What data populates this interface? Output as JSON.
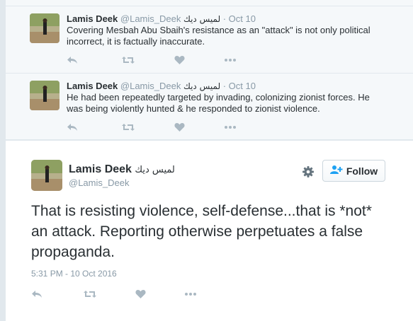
{
  "replies": [
    {
      "name": "Lamis Deek",
      "handle": "@Lamis_Deek",
      "name_ar": "لميس ديك",
      "date": "· Oct 10",
      "text": "Covering Mesbah Abu Sbaih's resistance as an \"attack\" is not only political incorrect, it is factually inaccurate."
    },
    {
      "name": "Lamis Deek",
      "handle": "@Lamis_Deek",
      "name_ar": "لميس ديك",
      "date": "· Oct 10",
      "text": "He had been repeatedly targeted by invading, colonizing zionist forces. He was being violently hunted & he responded to zionist violence."
    }
  ],
  "main_tweet": {
    "name": "Lamis Deek",
    "name_ar": "لميس ديك",
    "handle": "@Lamis_Deek",
    "follow_label": "Follow",
    "text": "That is resisting violence, self-defense...that is *not* an attack. Reporting otherwise perpetuates a false propaganda.",
    "timestamp": "5:31 PM - 10 Oct 2016"
  },
  "icons": [
    "reply-icon",
    "retweet-icon",
    "like-icon",
    "more-icon",
    "gear-icon",
    "follow-user-icon"
  ],
  "colors": {
    "background": "#f5f8fa",
    "text": "#292f33",
    "muted": "#8899a6",
    "action_icon": "#aab8c2",
    "follow_accent": "#1da1f2"
  }
}
